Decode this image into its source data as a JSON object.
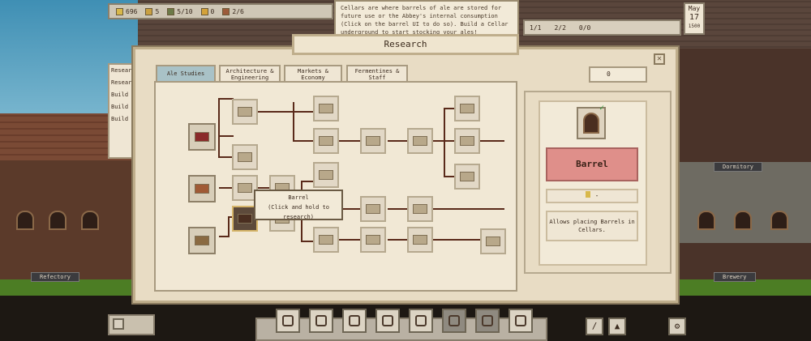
{
  "hud": {
    "gold": "696",
    "coins": "5",
    "monks": "5/10",
    "item_a": "0",
    "item_b": "2/6",
    "stat_a": "1/1",
    "stat_b": "2/2",
    "stat_c": "0/0",
    "date_month": "May",
    "date_day": "17",
    "date_year": "1500"
  },
  "notification": "Cellars are where barrels of ale are stored for future use or the Abbey's internal consumption (Click on the barrel UI to do so). Build a Cellar underground to start stocking your ales!",
  "side_tasks": [
    "Resear Tech tr",
    "Resear Tech tr",
    "Build a underg",
    "Build a",
    "Build a"
  ],
  "world_labels": {
    "refectory": "Refectory",
    "brewery": "Brewery",
    "dormitory": "Dormitory"
  },
  "dialog": {
    "title": "Research",
    "close_label": "✕",
    "tabs": [
      "Ale Studies",
      "Architecture & Engineering",
      "Markets & Economy",
      "Fermentines & Staff"
    ],
    "active_tab": "Ale Studies",
    "research_points": "0",
    "tooltip_title": "Barrel",
    "tooltip_hint": "(Click and hold to research)",
    "detail": {
      "name": "Barrel",
      "cost": "-",
      "description": "Allows placing Barrels in Cellars.",
      "unlocked": true
    }
  },
  "toolbar": {
    "buttons": [
      "search-icon",
      "map-icon",
      "chart-icon",
      "tools-icon",
      "build-icon",
      "storage-icon",
      "trade-icon",
      "sack-icon"
    ],
    "extra": [
      "slash-icon",
      "bell-icon"
    ],
    "settings_icon": "gear-icon"
  },
  "colors": {
    "selected_node": "#df8f8a",
    "active_tab": "#a9c2c7",
    "panel": "#e8dcc4"
  }
}
